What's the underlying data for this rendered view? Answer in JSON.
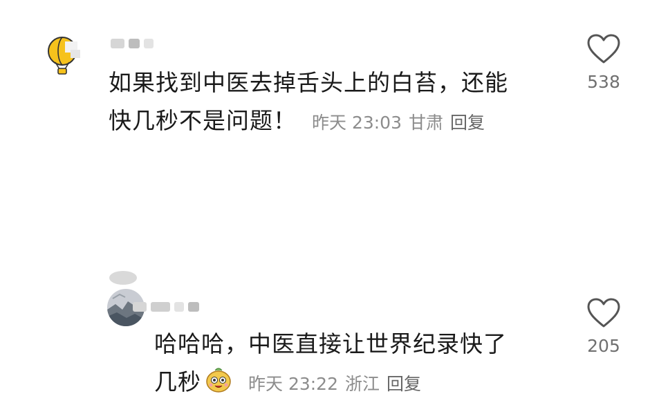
{
  "comments": [
    {
      "text_line1": "如果找到中医去掉舌头上的白苔，还能",
      "text_line2": "快几秒不是问题！",
      "time": "昨天 23:03",
      "location": "甘肃",
      "reply_label": "回复",
      "likes": "538",
      "avatar_icon": "hot-air-balloon-icon"
    },
    {
      "text_line1": "哈哈哈，中医直接让世界纪录快了",
      "text_line2": "几秒",
      "time": "昨天 23:22",
      "location": "浙江",
      "reply_label": "回复",
      "likes": "205",
      "emoji_icon": "smiling-fruit-emoji-icon"
    }
  ]
}
